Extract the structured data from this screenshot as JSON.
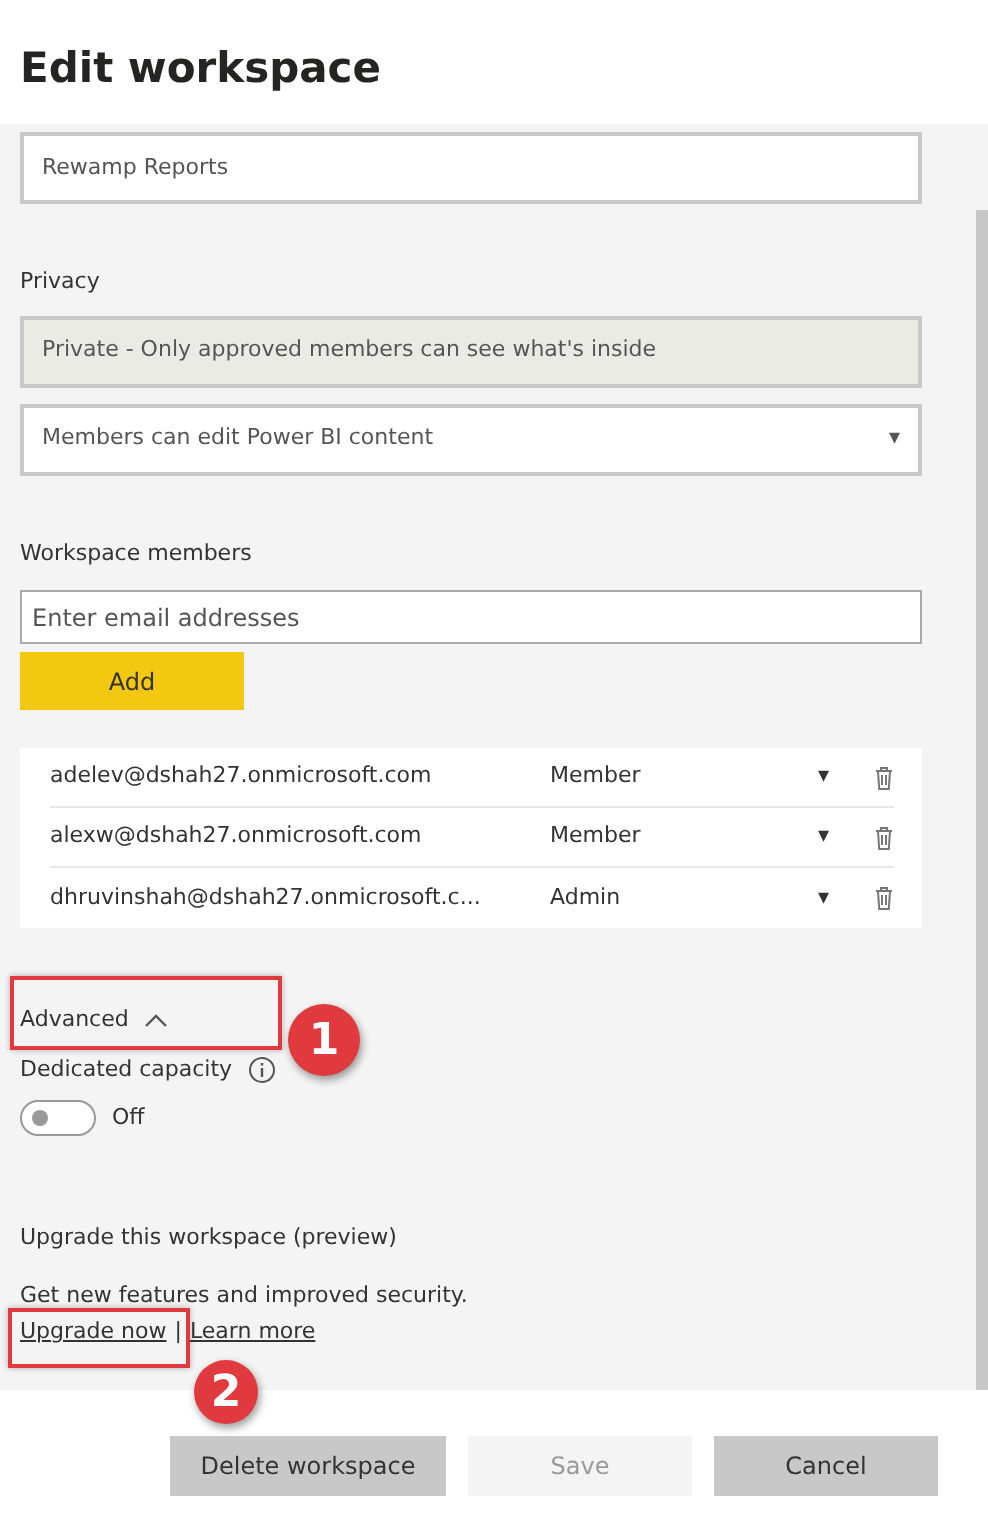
{
  "title": "Edit workspace",
  "name_field": {
    "value": "Rewamp Reports"
  },
  "privacy": {
    "label": "Privacy",
    "value": "Private - Only approved members can see what's inside",
    "disabled": true
  },
  "permission_select": {
    "value": "Members can edit Power BI content",
    "caret": "▾"
  },
  "members_section": {
    "label": "Workspace members",
    "placeholder": "Enter email addresses",
    "add_button": "Add"
  },
  "members": [
    {
      "email": "adelev@dshah27.onmicrosoft.com",
      "role": "Member",
      "caret": "▾"
    },
    {
      "email": "alexw@dshah27.onmicrosoft.com",
      "role": "Member",
      "caret": "▾"
    },
    {
      "email": "dhruvinshah@dshah27.onmicrosoft.c...",
      "role": "Admin",
      "caret": "▾"
    }
  ],
  "advanced": {
    "label": "Advanced",
    "expanded": true
  },
  "dedicated_capacity": {
    "label": "Dedicated capacity",
    "on": false,
    "state_text": "Off"
  },
  "upgrade": {
    "title": "Upgrade this workspace (preview)",
    "text": "Get new features and improved security.",
    "links": [
      "Upgrade now",
      "Learn more"
    ],
    "separator": "|"
  },
  "buttons": [
    {
      "label": "Delete workspace",
      "disabled": false
    },
    {
      "label": "Save",
      "disabled": true
    },
    {
      "label": "Cancel",
      "disabled": false
    }
  ],
  "annotations": [
    {
      "label": "1"
    },
    {
      "label": "2"
    }
  ]
}
